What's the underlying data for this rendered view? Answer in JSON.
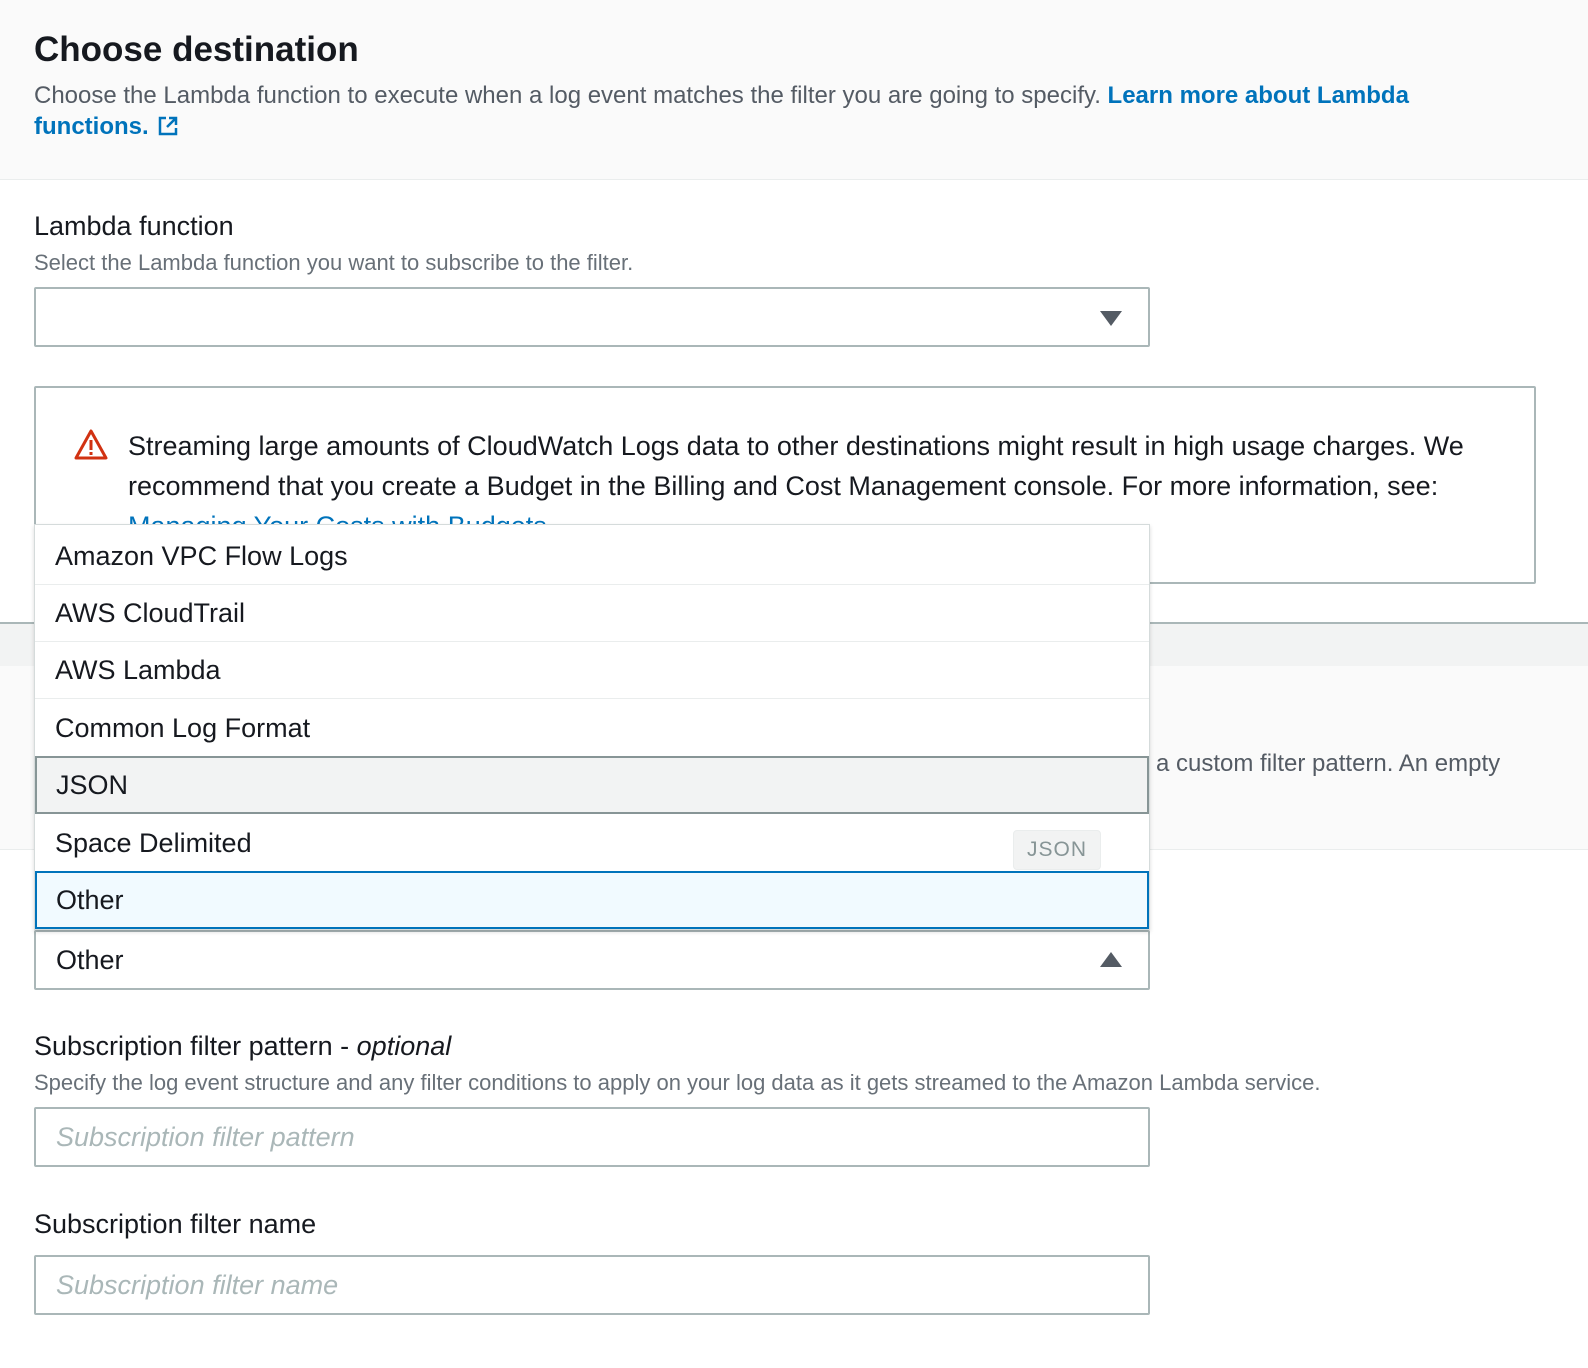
{
  "header": {
    "title": "Choose destination",
    "description": "Choose the Lambda function to execute when a log event matches the filter you are going to specify.",
    "learn_more_link": "Learn more about Lambda functions."
  },
  "lambda_function": {
    "label": "Lambda function",
    "description": "Select the Lambda function you want to subscribe to the filter.",
    "value": ""
  },
  "alert": {
    "text": "Streaming large amounts of CloudWatch Logs data to other destinations might result in high usage charges. We recommend that you create a Budget in the Billing and Cost Management console. For more information, see:",
    "link": "Managing Your Costs with Budgets"
  },
  "log_format": {
    "partial_text": "a custom filter pattern. An empty",
    "value": "Other",
    "options": [
      "Amazon VPC Flow Logs",
      "AWS CloudTrail",
      "AWS Lambda",
      "Common Log Format",
      "JSON",
      "Space Delimited",
      "Other"
    ],
    "hover_tag": "JSON"
  },
  "filter_pattern": {
    "label": "Subscription filter pattern - ",
    "label_optional": "optional",
    "description": "Specify the log event structure and any filter conditions to apply on your log data as it gets streamed to the Amazon Lambda service.",
    "placeholder": "Subscription filter pattern"
  },
  "filter_name": {
    "label": "Subscription filter name",
    "placeholder": "Subscription filter name"
  },
  "colors": {
    "link": "#0073bb",
    "warning": "#d13212",
    "border": "#aab7b8"
  }
}
